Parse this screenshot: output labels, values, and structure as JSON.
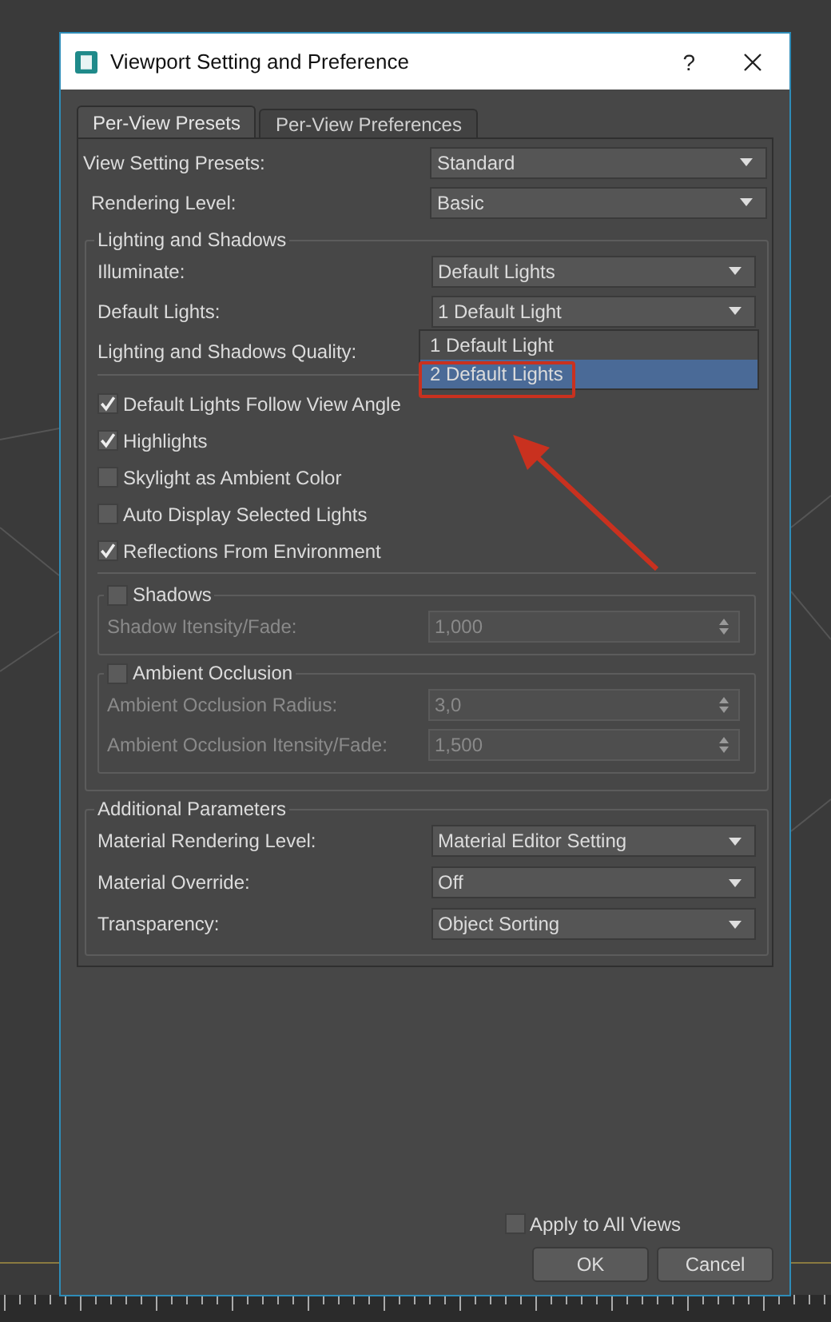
{
  "window": {
    "title": "Viewport Setting and Preference",
    "help": "?"
  },
  "tabs": [
    {
      "label": "Per-View Presets",
      "selected": true
    },
    {
      "label": "Per-View Preferences",
      "selected": false
    }
  ],
  "presets": [
    {
      "label": "View Setting Presets:",
      "kind": "dropdown",
      "value": "Standard"
    },
    {
      "label": "Rendering Level:",
      "kind": "dropdown",
      "value": "Basic"
    }
  ],
  "lighting": {
    "title": "Lighting and Shadows",
    "fields": [
      {
        "label": "Illuminate:",
        "kind": "dropdown",
        "value": "Default Lights"
      },
      {
        "label": "Default Lights:",
        "kind": "dropdown",
        "value": "1 Default Light",
        "expanded": true,
        "options": [
          {
            "label": "1 Default Light",
            "highlighted": false,
            "marked": false
          },
          {
            "label": "2 Default Lights",
            "highlighted": true,
            "marked": true
          }
        ]
      },
      {
        "label": "Lighting and Shadows Quality:",
        "kind": "hidden"
      }
    ],
    "checkboxes": [
      {
        "label": "Default Lights Follow View Angle",
        "checked": true
      },
      {
        "label": "Highlights",
        "checked": true
      },
      {
        "label": "Skylight as Ambient Color",
        "checked": false
      },
      {
        "label": "Auto Display Selected Lights",
        "checked": false
      },
      {
        "label": "Reflections From Environment",
        "checked": true
      }
    ],
    "subgroups": [
      {
        "title": "Shadows",
        "checked": false,
        "fields": [
          {
            "label": "Shadow Itensity/Fade:",
            "kind": "spinner",
            "value": "1,000",
            "disabled": true
          }
        ]
      },
      {
        "title": "Ambient Occlusion",
        "checked": false,
        "fields": [
          {
            "label": "Ambient Occlusion Radius:",
            "kind": "spinner",
            "value": "3,0",
            "disabled": true
          },
          {
            "label": "Ambient Occlusion Itensity/Fade:",
            "kind": "spinner",
            "value": "1,500",
            "disabled": true
          }
        ]
      }
    ]
  },
  "additional": {
    "title": "Additional Parameters",
    "fields": [
      {
        "label": "Material Rendering Level:",
        "kind": "dropdown",
        "value": "Material Editor Setting"
      },
      {
        "label": "Material Override:",
        "kind": "dropdown",
        "value": "Off"
      },
      {
        "label": "Transparency:",
        "kind": "dropdown",
        "value": "Object Sorting"
      }
    ]
  },
  "footer": {
    "apply_all": {
      "label": "Apply to All Views",
      "checked": false
    },
    "buttons": [
      "OK",
      "Cancel"
    ]
  }
}
